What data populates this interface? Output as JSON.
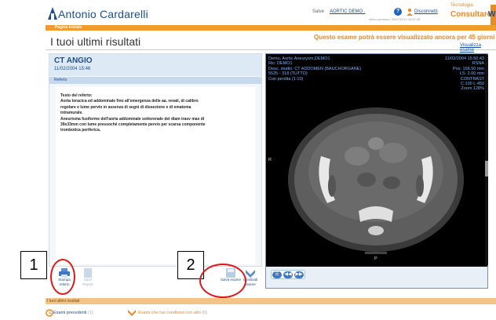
{
  "header": {
    "logo_text": "Antonio Cardarelli",
    "salve": "Salve",
    "user": "AORTIC DEMO .",
    "help": "?",
    "logout": "Disconnetti",
    "last_access": "ultimo accesso: 25/07/2010 18:57:38",
    "brand_top": "Tecnologia",
    "brand_main": "Consultare",
    "brand_side": "W"
  },
  "nav": {
    "home": "Pagina iniziale"
  },
  "page": {
    "title": "I tuoi ultimi risultati",
    "warning": "Questo esame potrà essere visualizzato ancora per 45 giorni",
    "view_link": "Visualizza esame"
  },
  "exam": {
    "title": "CT ANGIO",
    "date": "11/02/2004 15:46",
    "section": "Referto",
    "report_lines": [
      "Testo del referto:",
      "Aorta toracica ed addominale fino all'emergenza delle aa. renali, di calibro",
      "regolare e lume pervio in assenza di segni di dissezione e di ematoma",
      "intramurale.",
      "Aneurisma fusiforme dell'aorta addominale sottorenale del diam trasv max di",
      "39x33mm con lume pressoché completamente pervio per scarsa componente",
      "trombotica periferica."
    ]
  },
  "buttons": {
    "stampa": "Stampa referto",
    "save_report": "Save Report",
    "salva": "Salva esame",
    "condividi": "Condividi esame"
  },
  "viewer": {
    "left_lines": [
      "Demo, Aortic Aneurysm,DEMO1",
      "Ric: DEMO1",
      "Desc. studio: CT ADDOMEN (BAUCHORGANE)",
      "5525 - 318 (TUTTO)"
    ],
    "left_red": "Con perdita (1:10)",
    "right_lines": [
      "11/02/2004 15:50:43",
      "RSNA",
      "Pos: 168.50 mm",
      "LS: 2.00 mm",
      "CONTRAST",
      "C:100 L:450",
      "Zoom 128%"
    ],
    "orient_left": "R",
    "orient_bottom": "P"
  },
  "footer": {
    "title": "I tuoi ultimi risultati",
    "prev_label": "Esami precedenti",
    "prev_count": "(1)",
    "shared_label": "Esami che hai condiviso con altri",
    "shared_count": "(0)"
  },
  "callouts": [
    "1",
    "2"
  ],
  "colors": {
    "accent": "#f29a2e",
    "brand": "#1c4f8a",
    "annotation": "#e0161a"
  }
}
